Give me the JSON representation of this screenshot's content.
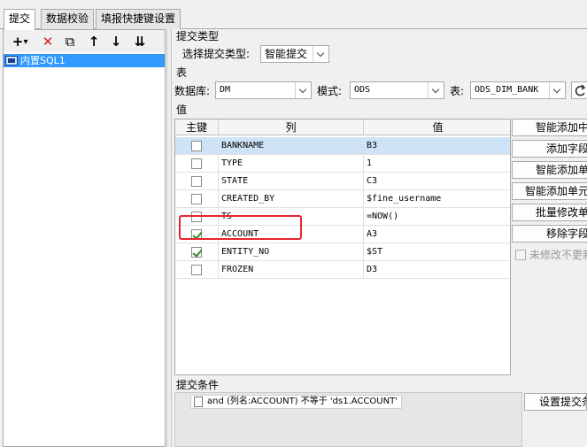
{
  "tabs": [
    {
      "label": "提交",
      "active": true
    },
    {
      "label": "数据校验",
      "active": false
    },
    {
      "label": "填报快捷键设置",
      "active": false
    }
  ],
  "left_toolbar": {
    "add": "+",
    "add_dropdown": "▾",
    "delete": "✕",
    "copy": "⧉",
    "move_up": "↑",
    "move_down": "↓",
    "move_bottom": "⇊"
  },
  "tree": {
    "items": [
      {
        "label": "内置SQL1"
      }
    ]
  },
  "submit_type": {
    "section_title": "提交类型",
    "label": "选择提交类型:",
    "value": "智能提交"
  },
  "table_section": {
    "section_title": "表",
    "db_label": "数据库:",
    "db_value": "DM",
    "schema_label": "模式:",
    "schema_value": "ODS",
    "table_label": "表:",
    "table_value": "ODS_DIM_BANK",
    "refresh_icon": "refresh-icon"
  },
  "values_section": {
    "section_title": "值",
    "headers": {
      "key": "主键",
      "column": "列",
      "value": "值"
    },
    "rows": [
      {
        "key": false,
        "column": "BANKNAME",
        "value": "B3",
        "selected": true
      },
      {
        "key": false,
        "column": "TYPE",
        "value": "1",
        "selected": false
      },
      {
        "key": false,
        "column": "STATE",
        "value": "C3",
        "selected": false
      },
      {
        "key": false,
        "column": "CREATED_BY",
        "value": "$fine_username",
        "selected": false
      },
      {
        "key": false,
        "column": "TS",
        "value": "=NOW()",
        "selected": false
      },
      {
        "key": true,
        "column": "ACCOUNT",
        "value": "A3",
        "selected": false
      },
      {
        "key": true,
        "column": "ENTITY_NO",
        "value": "$ST",
        "selected": false
      },
      {
        "key": false,
        "column": "FROZEN",
        "value": "D3",
        "selected": false
      }
    ]
  },
  "side_buttons": [
    {
      "label": "智能添加中"
    },
    {
      "label": "添加字段"
    },
    {
      "label": "智能添加单"
    },
    {
      "label": "智能添加单元"
    },
    {
      "label": "批量修改单"
    },
    {
      "label": "移除字段"
    }
  ],
  "no_update_checkbox": {
    "label": "未修改不更新",
    "checked": false
  },
  "conditions": {
    "section_title": "提交条件",
    "items": [
      "and (列名:ACCOUNT) 不等于 'ds1.ACCOUNT'"
    ],
    "set_button": "设置提交条"
  },
  "colors": {
    "selection": "#3399ff",
    "highlight_box": "#e3262c",
    "check": "#2e8b2e"
  }
}
